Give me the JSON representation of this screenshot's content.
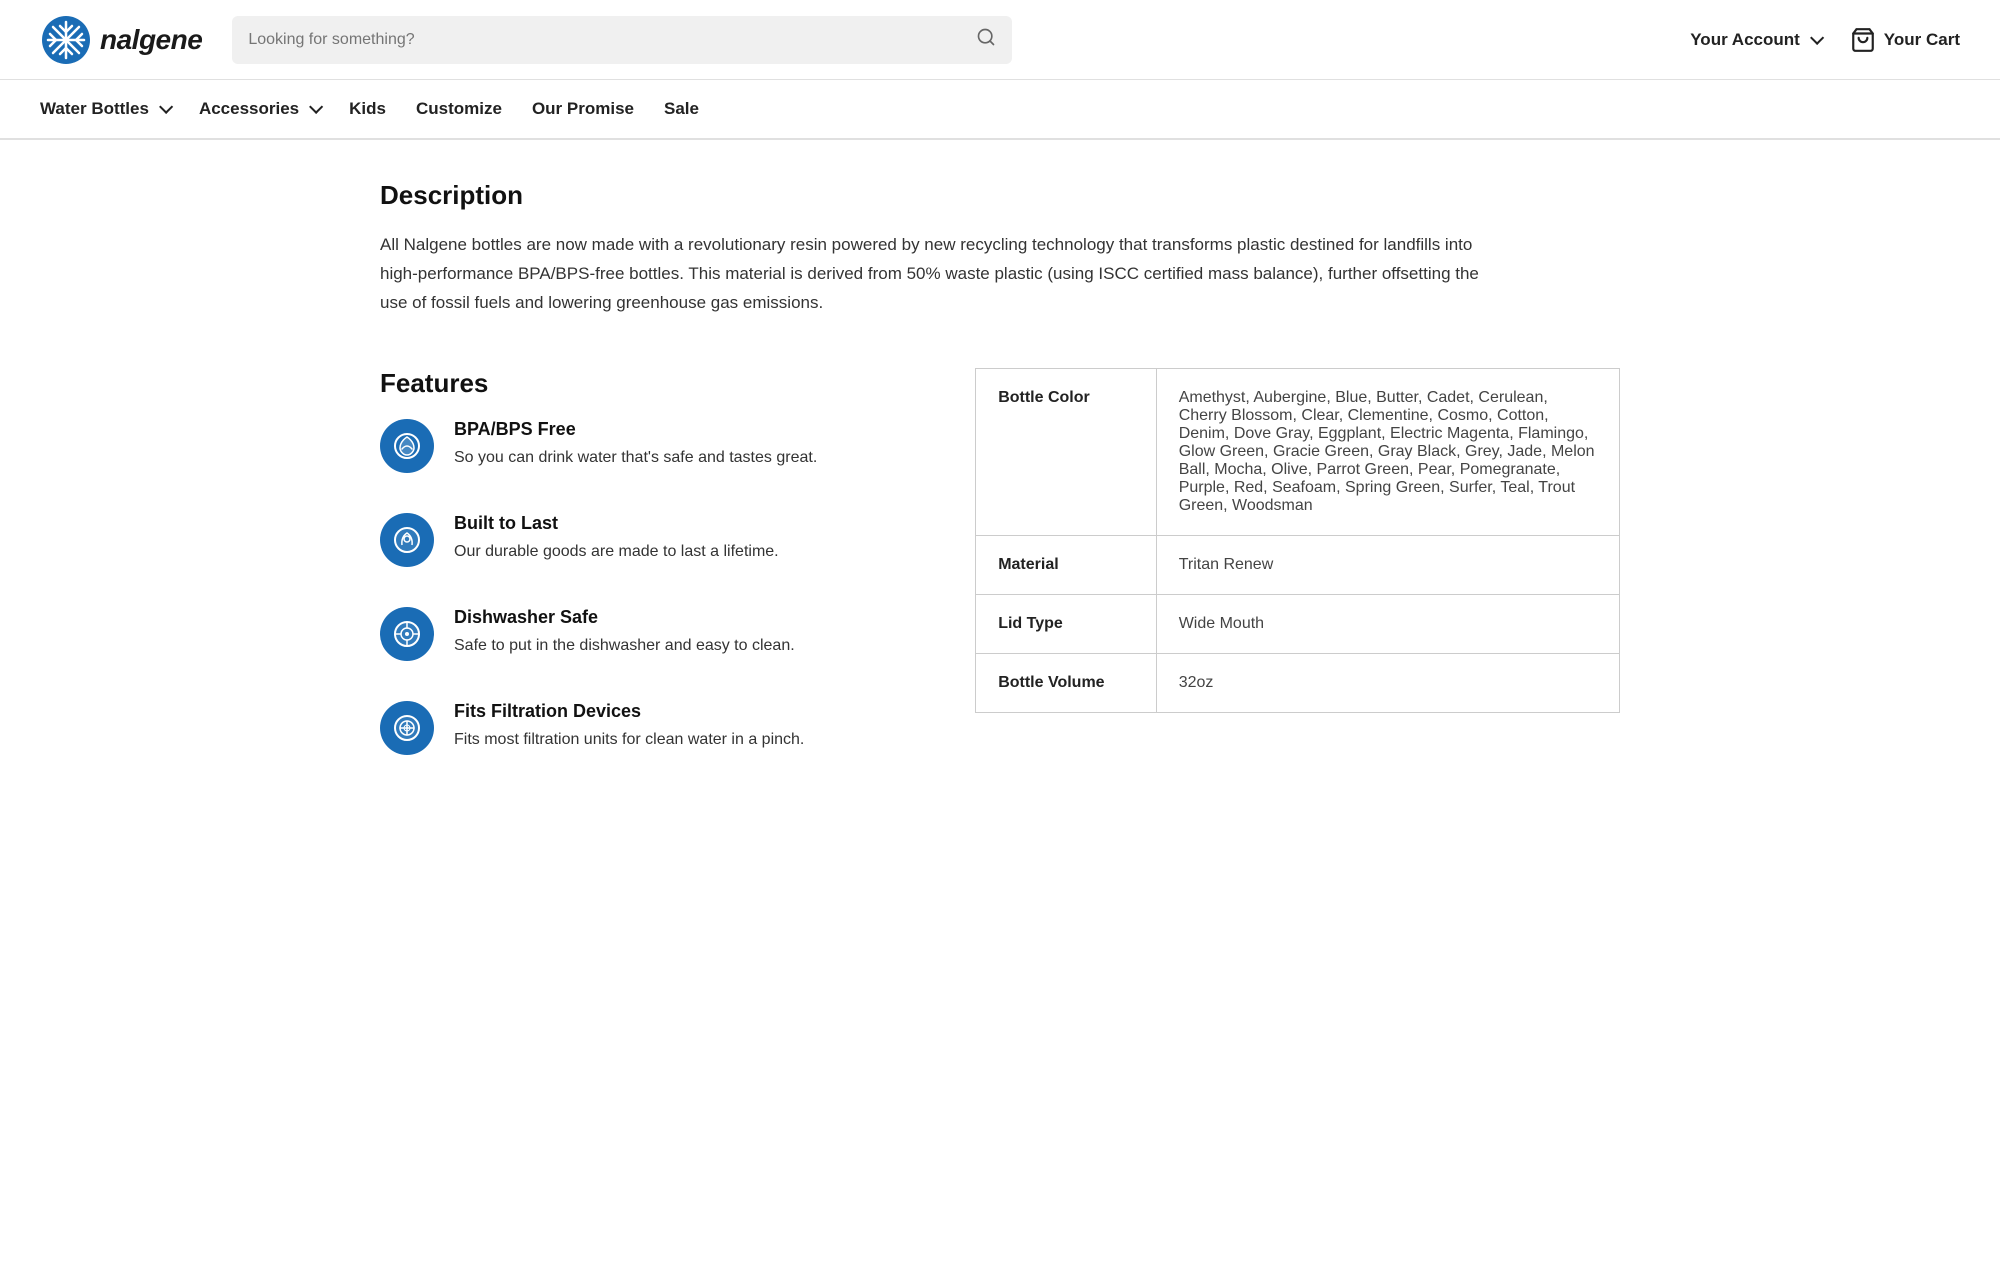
{
  "header": {
    "logo_text": "nalgene",
    "search_placeholder": "Looking for something?",
    "account_label": "Your Account",
    "cart_label": "Your Cart"
  },
  "nav": {
    "items": [
      {
        "label": "Water Bottles",
        "has_dropdown": true
      },
      {
        "label": "Accessories",
        "has_dropdown": true
      },
      {
        "label": "Kids",
        "has_dropdown": false
      },
      {
        "label": "Customize",
        "has_dropdown": false
      },
      {
        "label": "Our Promise",
        "has_dropdown": false
      },
      {
        "label": "Sale",
        "has_dropdown": false
      }
    ]
  },
  "description": {
    "title": "Description",
    "text": "All Nalgene bottles are now made with a revolutionary resin powered by new recycling technology that transforms plastic destined for landfills into high-performance BPA/BPS-free bottles. This material is derived from 50% waste plastic (using ISCC certified mass balance), further offsetting the use of fossil fuels and lowering greenhouse gas emissions."
  },
  "features": {
    "title": "Features",
    "items": [
      {
        "icon": "bpa-icon",
        "icon_char": "⟳",
        "title": "BPA/BPS Free",
        "description": "So you can drink water that's safe and tastes great."
      },
      {
        "icon": "durable-icon",
        "icon_char": "✋",
        "title": "Built to Last",
        "description": "Our durable goods are made to last a lifetime."
      },
      {
        "icon": "dishwasher-icon",
        "icon_char": "⚙",
        "title": "Dishwasher Safe",
        "description": "Safe to put in the dishwasher and easy to clean."
      },
      {
        "icon": "filter-icon",
        "icon_char": "⊕",
        "title": "Fits Filtration Devices",
        "description": "Fits most filtration units for clean water in a pinch."
      }
    ]
  },
  "specs": {
    "rows": [
      {
        "label": "Bottle Color",
        "value": "Amethyst, Aubergine, Blue, Butter, Cadet, Cerulean, Cherry Blossom, Clear, Clementine, Cosmo, Cotton, Denim, Dove Gray, Eggplant, Electric Magenta, Flamingo, Glow Green, Gracie Green, Gray Black, Grey, Jade, Melon Ball, Mocha, Olive, Parrot Green, Pear, Pomegranate, Purple, Red, Seafoam, Spring Green, Surfer, Teal, Trout Green, Woodsman"
      },
      {
        "label": "Material",
        "value": "Tritan Renew"
      },
      {
        "label": "Lid Type",
        "value": "Wide Mouth"
      },
      {
        "label": "Bottle Volume",
        "value": "32oz"
      }
    ]
  }
}
